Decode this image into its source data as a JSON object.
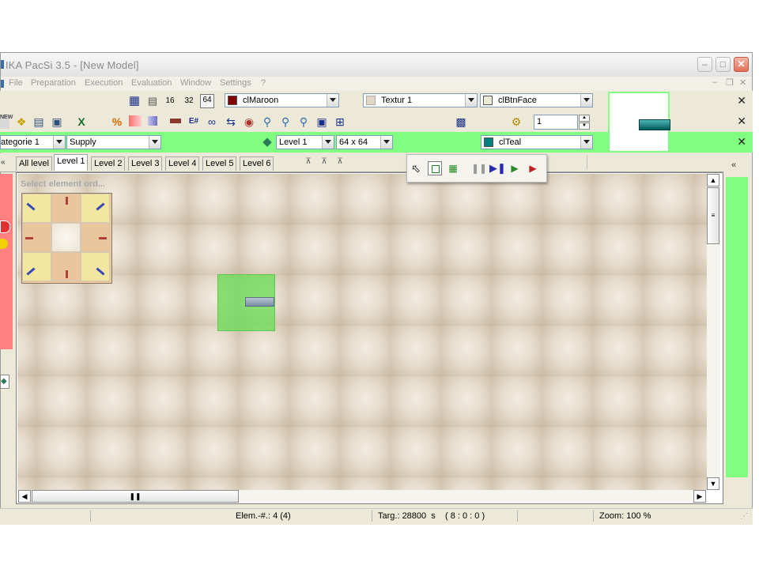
{
  "window": {
    "title": "IKA PacSi 3.5 - [New Model]"
  },
  "menu": [
    "File",
    "Preparation",
    "Execution",
    "Evaluation",
    "Window",
    "Settings",
    "?"
  ],
  "toolbar1": {
    "grid_sizes": [
      "16",
      "32",
      "64"
    ],
    "color_combo": {
      "value": "clMaroon",
      "swatch": "#800000"
    },
    "texture_combo": {
      "value": "Textur 1",
      "swatch": "#e2d6c4"
    },
    "bg_combo": {
      "value": "clBtnFace",
      "swatch": "#ece9d8"
    }
  },
  "toolbar2": {
    "percent_icon": "%",
    "e_hash_icon": "E#",
    "counter_value": "1"
  },
  "toolbar3": {
    "category_combo": "ategorie 1",
    "type_combo": "Supply",
    "level_combo": "Level 1",
    "size_combo": "64  x 64",
    "color_combo": {
      "value": "clTeal",
      "swatch": "#008080"
    }
  },
  "tabs": [
    "All level",
    "Level 1",
    "Level 2",
    "Level 3",
    "Level 4",
    "Level 5",
    "Level 6"
  ],
  "active_tab": "Level 1",
  "select_panel": {
    "title": "Select element ord..."
  },
  "status": {
    "elements": "Elem.-#.: 4 (4)",
    "target": "Targ.: 28800  s    ( 8 : 0 : 0 )",
    "zoom": "Zoom: 100 %"
  },
  "colors": {
    "green_bar": "#80ff80",
    "sidebar_red": "#ff8080",
    "selection": "#7ddc6a"
  }
}
